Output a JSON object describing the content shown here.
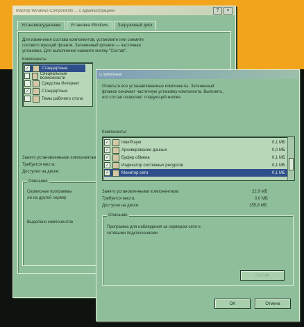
{
  "back_window": {
    "title": "Мастер Windows Components ... с администрацией",
    "tabs": [
      "Установка/удаление",
      "Установка Windows",
      "Загрузочный диск"
    ],
    "intro": [
      "Для изменения состава компонентов, установите или снимите",
      "соответствующий флажок. Затененный флажок — частичная",
      "установка. Для выполнения нажмите кнопку \"Состав\"."
    ],
    "components_label": "Компоненты:",
    "items": [
      "Стандартные",
      "Специальные возможности",
      "Средства Интернет",
      "Стандартные",
      "Темы рабочего стола"
    ],
    "labels": [
      "Занято установленными компонентами:",
      "Требуется места:",
      "Доступно на диске:"
    ],
    "description_label": "Описание",
    "description_text": [
      "Сервисные программы",
      "ли на другой сервер"
    ],
    "selected_text": "Выделено компонентов"
  },
  "front_window": {
    "title": "Служебные",
    "intro": [
      "Отметьте все устанавливаемые компоненты. Затененный",
      "флажок означает частичную установку компонента. Выяснить,",
      "его состав позволяет следующей кнопке."
    ],
    "components_label": "Компоненты:",
    "components": [
      {
        "name": "InterPlayer",
        "size": "0,1 МБ",
        "checked": true,
        "selected": false
      },
      {
        "name": "Архивирование данных",
        "size": "0,0 МБ",
        "checked": true,
        "selected": false
      },
      {
        "name": "Буфер обмена",
        "size": "0,1 МБ",
        "checked": true,
        "selected": false
      },
      {
        "name": "Индикатор системных ресурсов",
        "size": "0,1 МБ",
        "checked": true,
        "selected": false
      },
      {
        "name": "Монитор сети",
        "size": "0,1 МБ",
        "checked": true,
        "selected": true
      }
    ],
    "space": [
      {
        "label": "Занято установленными компонентами:",
        "value": "22,9 МБ"
      },
      {
        "label": "Требуется места:",
        "value": "0,0 МБ"
      },
      {
        "label": "Доступно на диске:",
        "value": "155,8 МБ"
      }
    ],
    "description_label": "Описание",
    "description_text": [
      "Программа для наблюдения за сервером сети и",
      "сетевыми подключениями"
    ],
    "details_button": "Состав",
    "ok_button": "OK",
    "cancel_button": "Отмена"
  },
  "colors": {
    "accent": "#2f4f8c",
    "window": "#8fbf9a",
    "backdrop": "#f2a51c"
  }
}
